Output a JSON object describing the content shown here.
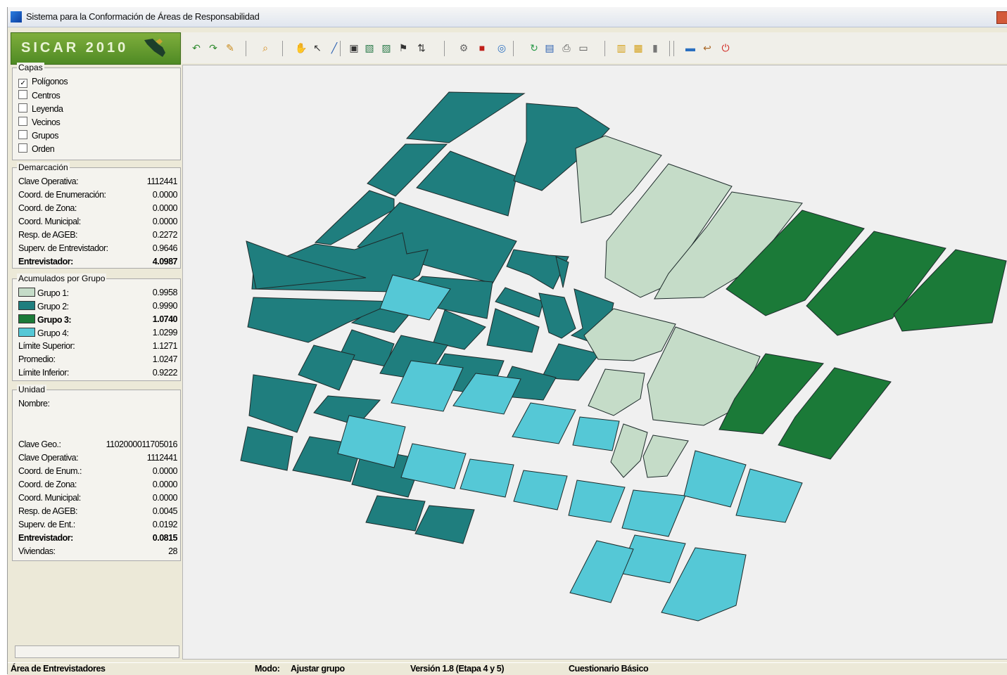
{
  "window": {
    "title": "Sistema para la Conformación de Áreas de Responsabilidad"
  },
  "logo": {
    "text": "SICAR 2010"
  },
  "toolbar": {
    "icons": [
      "undo-icon",
      "redo-icon",
      "pencil-icon",
      "search-icon",
      "hand-pan-icon",
      "pointer-select-icon",
      "line-icon",
      "select-group-icon",
      "polygon-icon",
      "polygon-edit-icon",
      "flag-icon",
      "sort-icon",
      "settings-icon",
      "counter-icon",
      "zoom-extent-icon",
      "refresh-icon",
      "save-icon",
      "print-icon",
      "document-icon",
      "folder-icon",
      "folder-open-icon",
      "book-icon",
      "monitor-icon",
      "undo-arrow-icon",
      "power-icon"
    ]
  },
  "layers": {
    "title": "Capas",
    "items": [
      {
        "label": "Polígonos",
        "checked": true
      },
      {
        "label": "Centros",
        "checked": false
      },
      {
        "label": "Leyenda",
        "checked": false
      },
      {
        "label": "Vecinos",
        "checked": false
      },
      {
        "label": "Grupos",
        "checked": false
      },
      {
        "label": "Orden",
        "checked": false
      }
    ]
  },
  "demarcacion": {
    "title": "Demarcación",
    "rows": [
      {
        "label": "Clave Operativa:",
        "value": "1112441"
      },
      {
        "label": "Coord. de Enumeración:",
        "value": "0.0000"
      },
      {
        "label": "Coord. de Zona:",
        "value": "0.0000"
      },
      {
        "label": "Coord. Municipal:",
        "value": "0.0000"
      },
      {
        "label": "Resp. de AGEB:",
        "value": "0.2272"
      },
      {
        "label": "Superv. de Entrevistador:",
        "value": "0.9646"
      },
      {
        "label": "Entrevistador:",
        "value": "4.0987",
        "bold": true
      }
    ]
  },
  "acumulados": {
    "title": "Acumulados por Grupo",
    "groups": [
      {
        "label": "Grupo 1:",
        "value": "0.9958",
        "color": "#c5dcc8"
      },
      {
        "label": "Grupo 2:",
        "value": "0.9990",
        "color": "#1f7e7e"
      },
      {
        "label": "Grupo 3:",
        "value": "1.0740",
        "color": "#1b7a38",
        "bold": true
      },
      {
        "label": "Grupo 4:",
        "value": "1.0299",
        "color": "#55c8d6"
      }
    ],
    "rows": [
      {
        "label": "Límite Superior:",
        "value": "1.1271"
      },
      {
        "label": "Promedio:",
        "value": "1.0247"
      },
      {
        "label": "Límite Inferior:",
        "value": "0.9222"
      }
    ]
  },
  "unidad": {
    "title": "Unidad",
    "nombre_label": "Nombre:",
    "nombre_value": "",
    "rows": [
      {
        "label": "Clave Geo.:",
        "value": "1102000011705016"
      },
      {
        "label": "Clave Operativa:",
        "value": "1112441"
      },
      {
        "label": "Coord. de Enum.:",
        "value": "0.0000"
      },
      {
        "label": "Coord. de Zona:",
        "value": "0.0000"
      },
      {
        "label": "Coord. Municipal:",
        "value": "0.0000"
      },
      {
        "label": "Resp. de AGEB:",
        "value": "0.0045"
      },
      {
        "label": "Superv. de Ent.:",
        "value": "0.0192"
      },
      {
        "label": "Entrevistador:",
        "value": "0.0815",
        "bold": true
      },
      {
        "label": "Viviendas:",
        "value": "28"
      }
    ]
  },
  "statusbar": {
    "area": "Área de Entrevistadores",
    "modo_label": "Modo:",
    "modo_value": "Ajustar grupo",
    "version": "Versión 1.8 (Etapa 4 y 5)",
    "cuestionario": "Cuestionario Básico"
  },
  "map": {
    "group_colors": {
      "g1": "#c5dcc8",
      "g2": "#1f7e7e",
      "g3": "#1b7a38",
      "g4": "#55c8d6"
    }
  }
}
